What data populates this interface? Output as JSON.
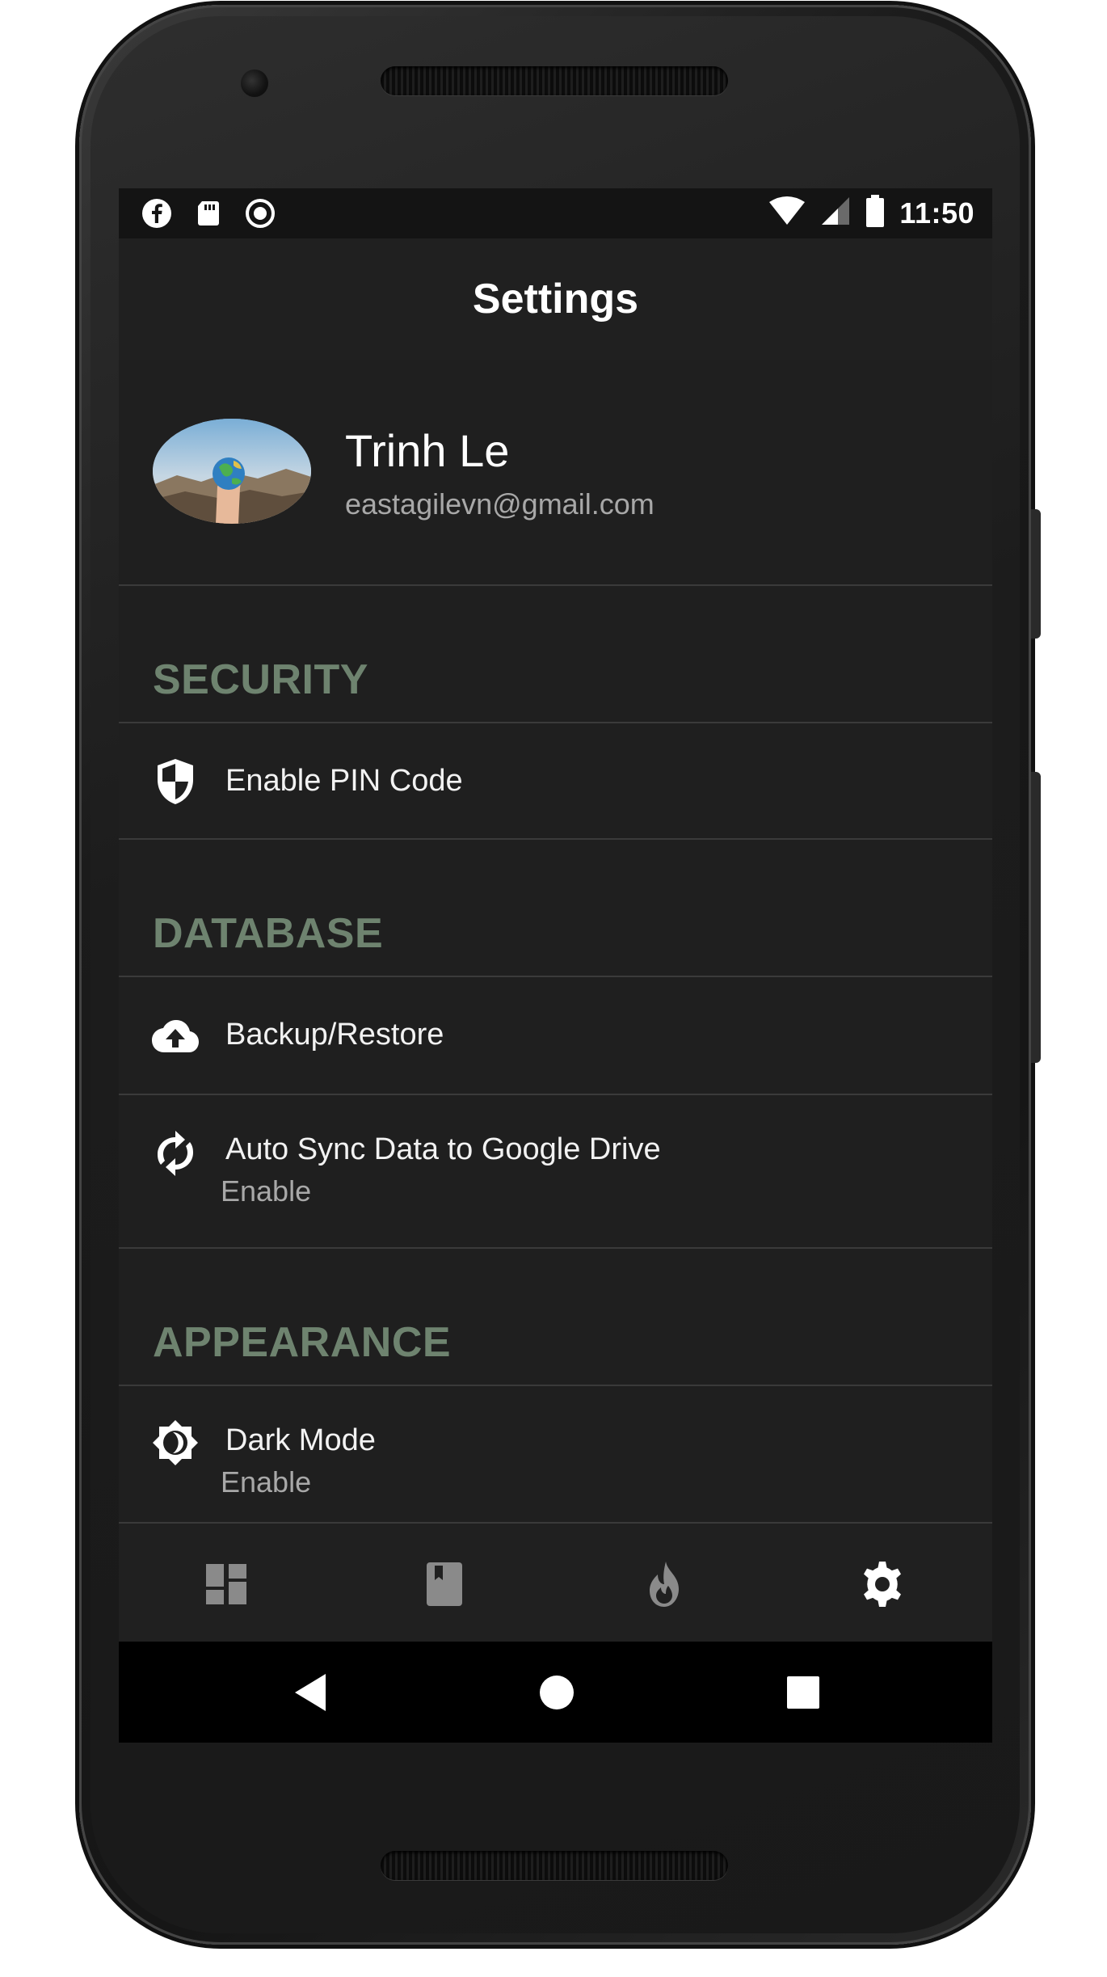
{
  "status_bar": {
    "time": "11:50",
    "left_icons": [
      "facebook-icon",
      "sd-card-icon",
      "record-icon"
    ],
    "right_icons": [
      "wifi-icon",
      "cell-signal-icon",
      "battery-icon"
    ]
  },
  "app_bar": {
    "title": "Settings"
  },
  "profile": {
    "name": "Trinh Le",
    "email": "eastagilevn@gmail.com",
    "avatar": "avatar-photo"
  },
  "sections": {
    "security": {
      "title": "SECURITY",
      "items": [
        {
          "label": "Enable PIN Code",
          "icon": "shield-icon"
        }
      ]
    },
    "database": {
      "title": "DATABASE",
      "items": [
        {
          "label": "Backup/Restore",
          "icon": "cloud-upload-icon"
        },
        {
          "label": "Auto Sync Data to Google Drive",
          "sub": "Enable",
          "icon": "sync-icon"
        }
      ]
    },
    "appearance": {
      "title": "APPEARANCE",
      "items": [
        {
          "label": "Dark Mode",
          "sub": "Enable",
          "icon": "dark-mode-icon"
        }
      ]
    }
  },
  "bottom_nav": {
    "items": [
      {
        "icon": "dashboard-icon",
        "active": false
      },
      {
        "icon": "book-icon",
        "active": false
      },
      {
        "icon": "fire-icon",
        "active": false
      },
      {
        "icon": "settings-gear-icon",
        "active": true
      }
    ]
  },
  "system_nav": [
    "back-icon",
    "home-icon",
    "recents-icon"
  ],
  "colors": {
    "background": "#1f1f1f",
    "section_title": "#6e836f",
    "divider": "#3a3a3a",
    "text_primary": "#f2f2f2",
    "text_secondary": "#a8a8a8",
    "nav_inactive": "#8a8a8a",
    "nav_active": "#ffffff"
  }
}
